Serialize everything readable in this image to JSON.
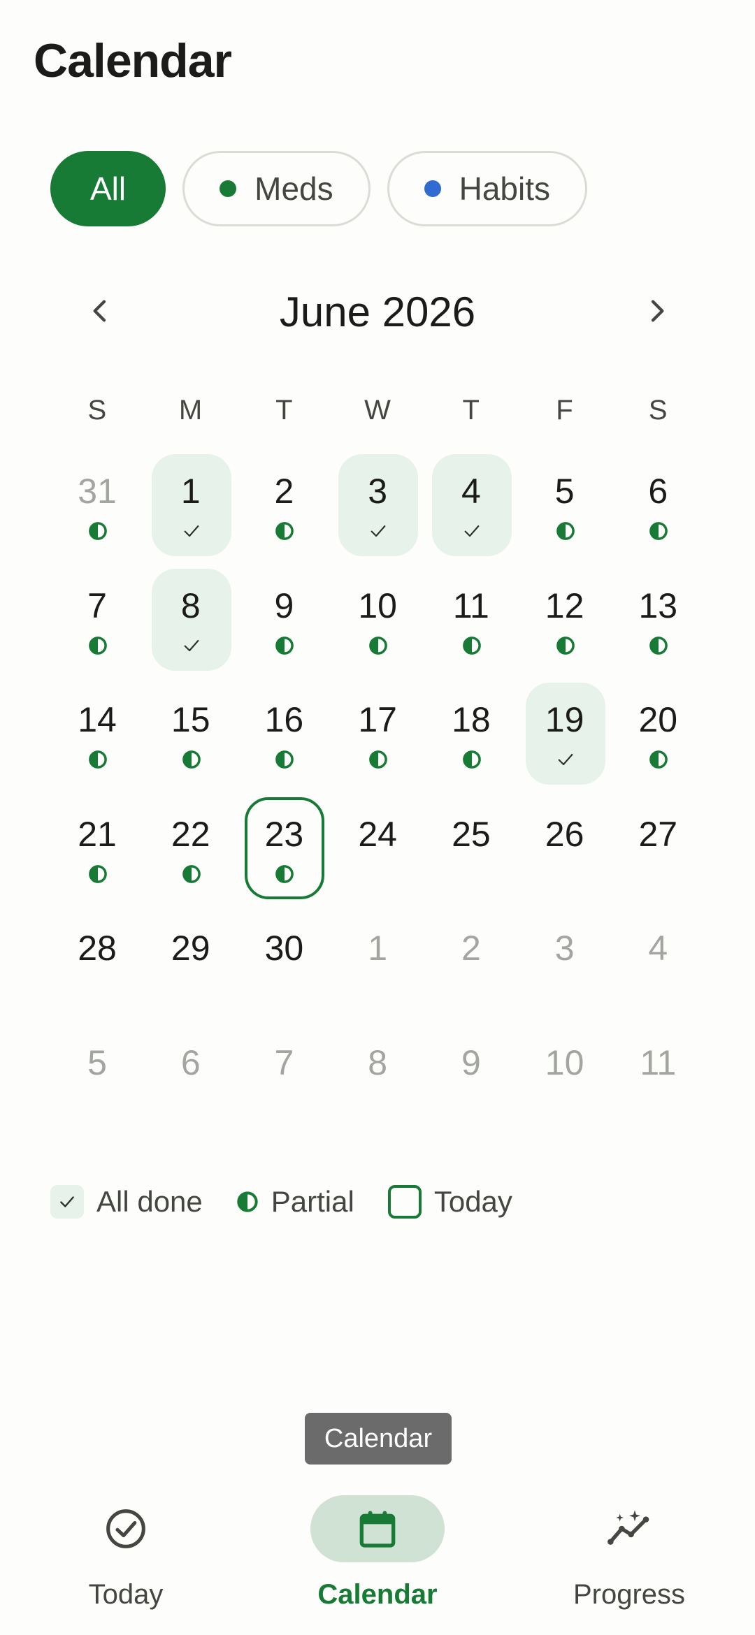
{
  "header": {
    "title": "Calendar"
  },
  "filters": [
    {
      "label": "All",
      "active": true,
      "dot_color": null
    },
    {
      "label": "Meds",
      "active": false,
      "dot_color": "#177a35"
    },
    {
      "label": "Habits",
      "active": false,
      "dot_color": "#2f6bd1"
    }
  ],
  "calendar": {
    "month_label": "June 2026",
    "prev_icon": "chevron-left-icon",
    "next_icon": "chevron-right-icon",
    "weekdays": [
      "S",
      "M",
      "T",
      "W",
      "T",
      "F",
      "S"
    ],
    "weeks": [
      [
        {
          "num": "31",
          "muted": true,
          "status": "partial"
        },
        {
          "num": "1",
          "muted": false,
          "status": "done"
        },
        {
          "num": "2",
          "muted": false,
          "status": "partial"
        },
        {
          "num": "3",
          "muted": false,
          "status": "done"
        },
        {
          "num": "4",
          "muted": false,
          "status": "done"
        },
        {
          "num": "5",
          "muted": false,
          "status": "partial"
        },
        {
          "num": "6",
          "muted": false,
          "status": "partial"
        }
      ],
      [
        {
          "num": "7",
          "muted": false,
          "status": "partial"
        },
        {
          "num": "8",
          "muted": false,
          "status": "done"
        },
        {
          "num": "9",
          "muted": false,
          "status": "partial"
        },
        {
          "num": "10",
          "muted": false,
          "status": "partial"
        },
        {
          "num": "11",
          "muted": false,
          "status": "partial"
        },
        {
          "num": "12",
          "muted": false,
          "status": "partial"
        },
        {
          "num": "13",
          "muted": false,
          "status": "partial"
        }
      ],
      [
        {
          "num": "14",
          "muted": false,
          "status": "partial"
        },
        {
          "num": "15",
          "muted": false,
          "status": "partial"
        },
        {
          "num": "16",
          "muted": false,
          "status": "partial"
        },
        {
          "num": "17",
          "muted": false,
          "status": "partial"
        },
        {
          "num": "18",
          "muted": false,
          "status": "partial"
        },
        {
          "num": "19",
          "muted": false,
          "status": "done"
        },
        {
          "num": "20",
          "muted": false,
          "status": "partial"
        }
      ],
      [
        {
          "num": "21",
          "muted": false,
          "status": "partial"
        },
        {
          "num": "22",
          "muted": false,
          "status": "partial"
        },
        {
          "num": "23",
          "muted": false,
          "status": "today-partial"
        },
        {
          "num": "24",
          "muted": false,
          "status": "none"
        },
        {
          "num": "25",
          "muted": false,
          "status": "none"
        },
        {
          "num": "26",
          "muted": false,
          "status": "none"
        },
        {
          "num": "27",
          "muted": false,
          "status": "none"
        }
      ],
      [
        {
          "num": "28",
          "muted": false,
          "status": "none"
        },
        {
          "num": "29",
          "muted": false,
          "status": "none"
        },
        {
          "num": "30",
          "muted": false,
          "status": "none"
        },
        {
          "num": "1",
          "muted": true,
          "status": "none"
        },
        {
          "num": "2",
          "muted": true,
          "status": "none"
        },
        {
          "num": "3",
          "muted": true,
          "status": "none"
        },
        {
          "num": "4",
          "muted": true,
          "status": "none"
        }
      ],
      [
        {
          "num": "5",
          "muted": true,
          "status": "none"
        },
        {
          "num": "6",
          "muted": true,
          "status": "none"
        },
        {
          "num": "7",
          "muted": true,
          "status": "none"
        },
        {
          "num": "8",
          "muted": true,
          "status": "none"
        },
        {
          "num": "9",
          "muted": true,
          "status": "none"
        },
        {
          "num": "10",
          "muted": true,
          "status": "none"
        },
        {
          "num": "11",
          "muted": true,
          "status": "none"
        }
      ]
    ]
  },
  "legend": {
    "done_label": "All done",
    "partial_label": "Partial",
    "today_label": "Today"
  },
  "tooltip": {
    "text": "Calendar"
  },
  "bottom_nav": [
    {
      "label": "Today",
      "icon": "check-circle-icon",
      "active": false
    },
    {
      "label": "Calendar",
      "icon": "calendar-icon",
      "active": true
    },
    {
      "label": "Progress",
      "icon": "progress-chart-icon",
      "active": false
    }
  ],
  "colors": {
    "accent": "#177a35",
    "done_bg": "#e7f2ea",
    "habits_dot": "#2f6bd1",
    "muted_text": "#a3a5a1"
  }
}
